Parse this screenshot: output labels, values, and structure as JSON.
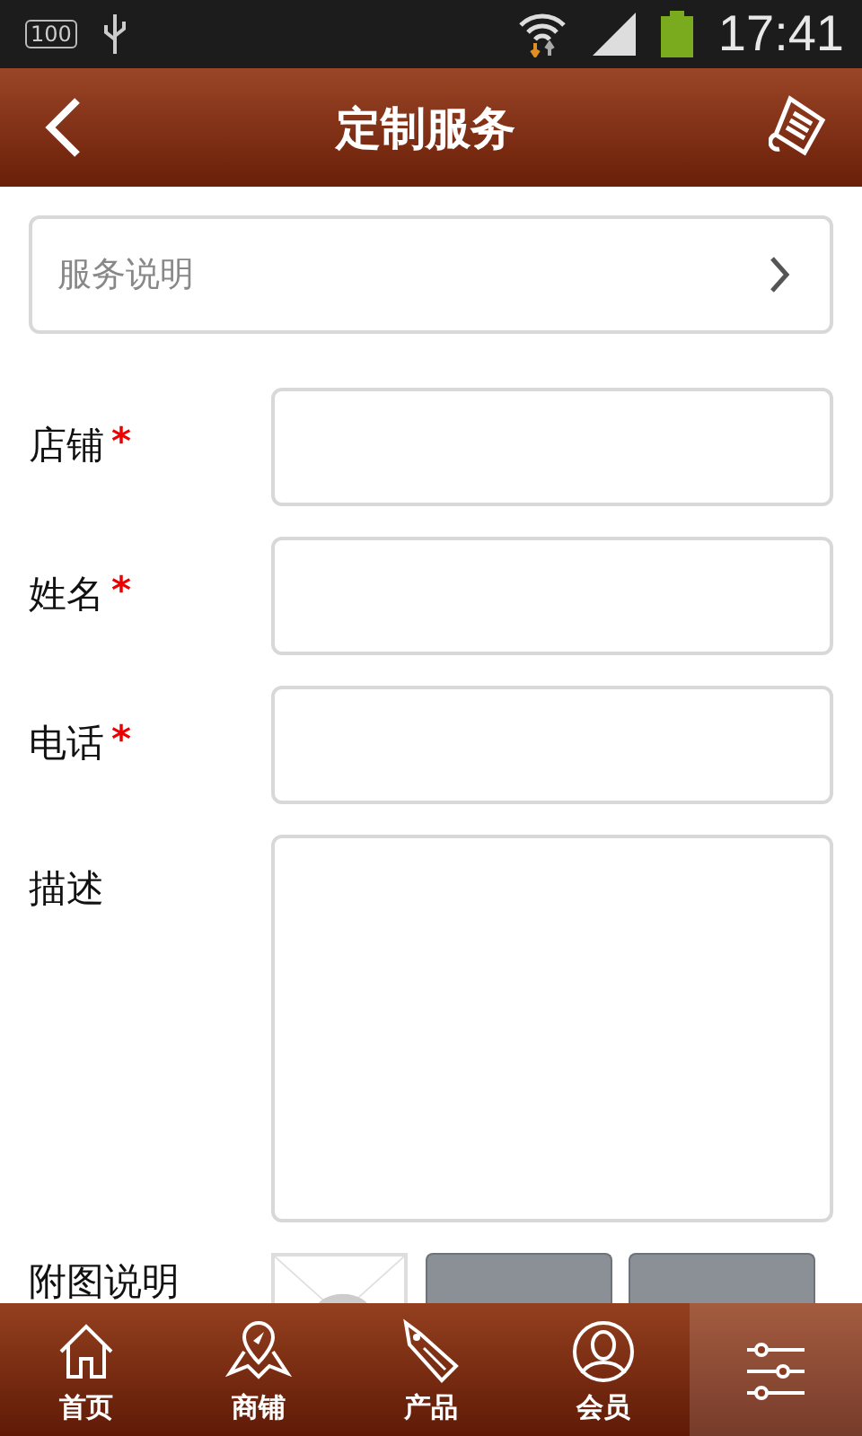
{
  "status_bar": {
    "battery_label": "100",
    "time": "17:41"
  },
  "header": {
    "title": "定制服务"
  },
  "service_row": {
    "label": "服务说明"
  },
  "form": {
    "fields": [
      {
        "label": "店铺",
        "required_mark": "*",
        "kind": "input"
      },
      {
        "label": "姓名",
        "required_mark": "*",
        "kind": "input"
      },
      {
        "label": "电话",
        "required_mark": "*",
        "kind": "input"
      },
      {
        "label": "描述",
        "kind": "textarea"
      }
    ],
    "attachment": {
      "label": "附图说明"
    }
  },
  "bottom_nav": [
    {
      "label": "首页",
      "selected": false
    },
    {
      "label": "商铺",
      "selected": false
    },
    {
      "label": "产品",
      "selected": false
    },
    {
      "label": "会员",
      "selected": false
    },
    {
      "selected": true
    }
  ]
}
